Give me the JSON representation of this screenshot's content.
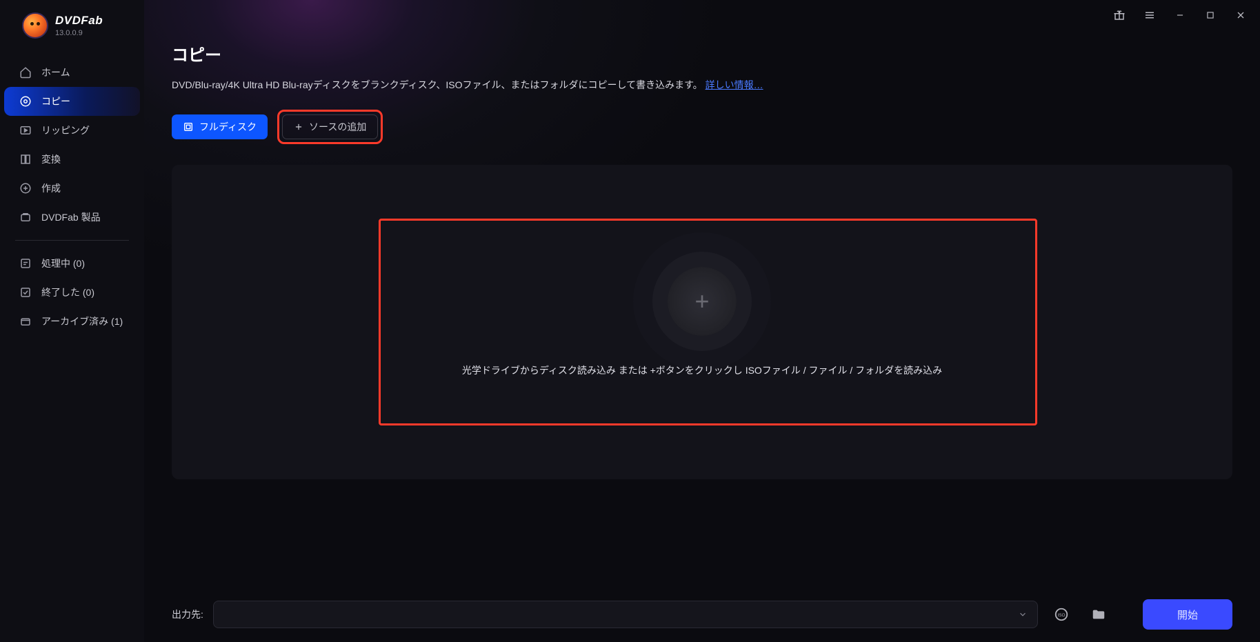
{
  "app": {
    "brand": "DVDFab",
    "version": "13.0.0.9"
  },
  "sidebar": {
    "items": [
      {
        "label": "ホーム",
        "icon": "home"
      },
      {
        "label": "コピー",
        "icon": "copy"
      },
      {
        "label": "リッピング",
        "icon": "ripping"
      },
      {
        "label": "変換",
        "icon": "convert"
      },
      {
        "label": "作成",
        "icon": "create"
      },
      {
        "label": "DVDFab 製品",
        "icon": "products"
      }
    ],
    "secondary": [
      {
        "label": "処理中 (0)",
        "icon": "processing"
      },
      {
        "label": "終了した (0)",
        "icon": "finished"
      },
      {
        "label": "アーカイブ済み (1)",
        "icon": "archived"
      }
    ]
  },
  "page": {
    "title": "コピー",
    "description": "DVD/Blu-ray/4K Ultra HD Blu-rayディスクをブランクディスク、ISOファイル、またはフォルダにコピーして書き込みます。",
    "more_info": "詳しい情報…"
  },
  "toolbar": {
    "full_disc": "フルディスク",
    "add_source": "ソースの追加"
  },
  "drop": {
    "text": "光学ドライブからディスク読み込み または  +ボタンをクリックし ISOファイル / ファイル / フォルダを読み込み"
  },
  "footer": {
    "output_label": "出力先:",
    "start": "開始"
  }
}
